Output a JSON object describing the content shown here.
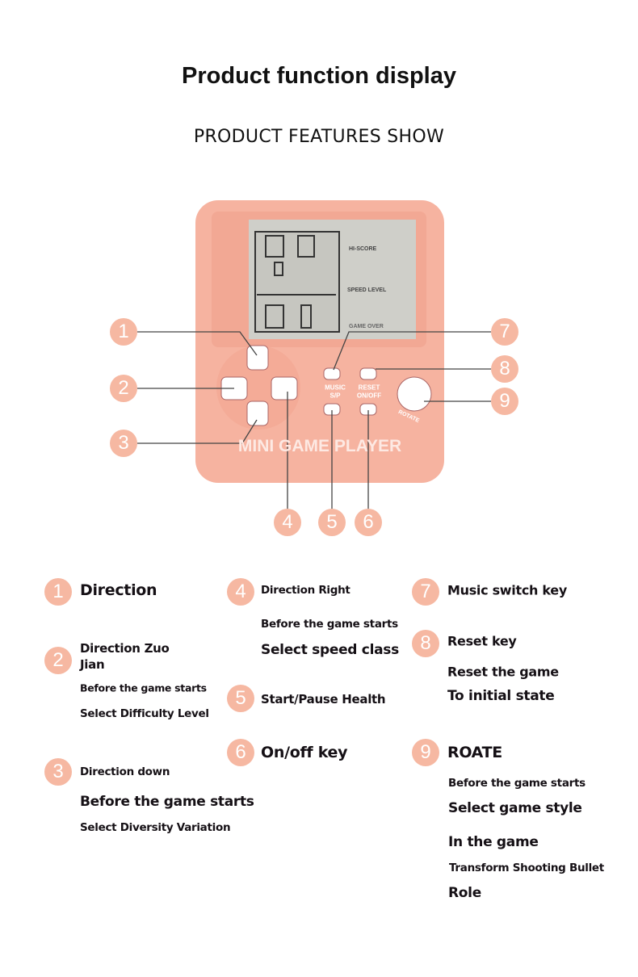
{
  "header": {
    "title": "Product function display",
    "subtitle": "PRODUCT FEATURES SHOW"
  },
  "device": {
    "brand_label": "MINI GAME PLAYER",
    "music_label": "MUSIC",
    "sp_label": "S/P",
    "reset_label": "RESET",
    "onoff_label": "ON/OFF",
    "rotate_label": "ROTATE",
    "screen": {
      "hiscore_label": "HI-SCORE",
      "speed_level_label": "SPEED LEVEL",
      "game_over_label": "GAME OVER"
    },
    "body_color": "#f6b3a0",
    "callout_color": "#f6b8a2",
    "callouts": [
      "1",
      "2",
      "3",
      "4",
      "5",
      "6",
      "7",
      "8",
      "9"
    ]
  },
  "features": [
    {
      "number": "1",
      "lines": [
        "Direction"
      ]
    },
    {
      "number": "2",
      "lines": [
        "Direction Zuo",
        "Jian",
        "Before the game starts",
        "Select Difficulty Level"
      ]
    },
    {
      "number": "3",
      "lines": [
        "Direction down",
        "Before the game starts",
        "Select Diversity Variation"
      ]
    },
    {
      "number": "4",
      "lines": [
        "Direction Right",
        "Before the game starts",
        "Select speed class"
      ]
    },
    {
      "number": "5",
      "lines": [
        "Start/Pause Health"
      ]
    },
    {
      "number": "6",
      "lines": [
        "On/off key"
      ]
    },
    {
      "number": "7",
      "lines": [
        "Music switch key"
      ]
    },
    {
      "number": "8",
      "lines": [
        "Reset key",
        "Reset the game",
        "To initial state"
      ]
    },
    {
      "number": "9",
      "lines": [
        "ROATE",
        "Before the game starts",
        "Select game style",
        "In the game",
        "Transform Shooting Bullet",
        "Role"
      ]
    }
  ]
}
